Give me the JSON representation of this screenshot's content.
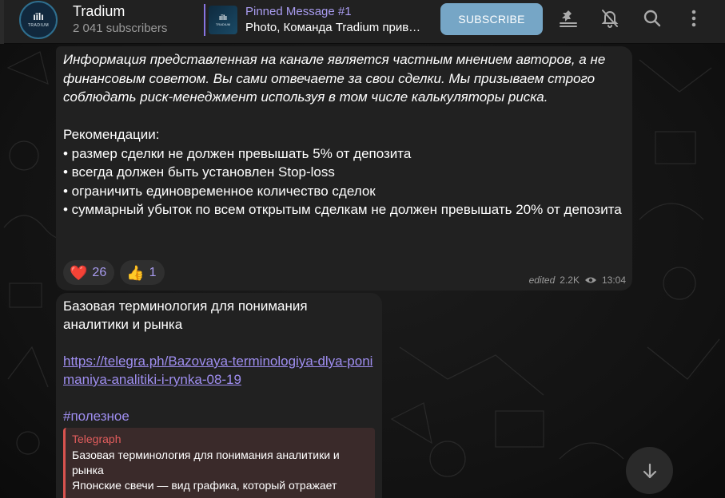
{
  "header": {
    "channel_title": "Tradium",
    "subscribers": "2 041 subscribers",
    "avatar_mark": "ıīlı",
    "avatar_text": "TRADIUM",
    "pinned_label": "Pinned Message #1",
    "pinned_text": "Photo, Команда Tradium приветствует",
    "subscribe_label": "SUBSCRIBE",
    "icons": [
      "pin-list-icon",
      "mute-bell-icon",
      "search-icon",
      "more-vertical-icon"
    ]
  },
  "messages": [
    {
      "italic_text": "Информация представленная на канале является частным мнением авторов, а не финансовым советом. Вы сами отвечаете за свои сделки. Мы призываем строго соблюдать риск-менеджмент используя в том числе калькуляторы риска.",
      "rec_heading": "Рекомендации:",
      "rec_items": [
        "• размер сделки не должен превышать 5% от депозита",
        "• всегда должен быть установлен Stop-loss",
        "• ограничить единовременное количество сделок",
        "• суммарный убыток по всем открытым сделкам не должен превышать 20% от депозита"
      ],
      "reactions": [
        {
          "emoji": "❤️",
          "count": "26"
        },
        {
          "emoji": "👍",
          "count": "1"
        }
      ],
      "edited": "edited",
      "views": "2.2K",
      "time": "13:04"
    },
    {
      "title": "Базовая терминология для понимания аналитики и рынка",
      "link": "https://telegra.ph/Bazovaya-terminologiya-dlya-ponimaniya-analitiki-i-rynka-08-19",
      "hashtag": "#полезное",
      "preview": {
        "site": "Telegraph",
        "title": "Базовая терминология для понимания аналитики и рынка",
        "description": "Японские свечи — вид графика, который отражает"
      }
    }
  ],
  "colors": {
    "accent": "#a99cf0",
    "subscribe_bg": "#76a6c6",
    "bubble_bg": "#212121",
    "header_bg": "#212121",
    "preview_bar": "#d9534f"
  }
}
